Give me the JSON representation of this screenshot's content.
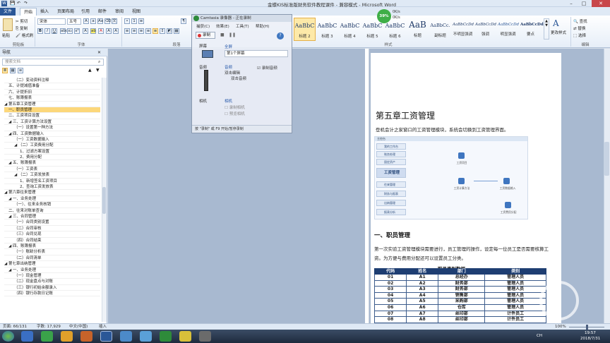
{
  "window": {
    "title": "金蝶KIS标准版财务软件教程课件 - 兼容模式 - Microsoft Word",
    "minimize": "–",
    "maximize": "□",
    "close": "✕"
  },
  "ribbon_tabs": [
    "文件",
    "开始",
    "插入",
    "页面布局",
    "引用",
    "邮件",
    "审阅",
    "视图"
  ],
  "ribbon": {
    "clipboard": {
      "paste": "粘贴",
      "cut": "剪切",
      "copy": "复制",
      "format_painter": "格式刷",
      "label": "剪贴板"
    },
    "font": {
      "name": "宋体",
      "size": "五号",
      "label": "字体"
    },
    "paragraph": {
      "label": "段落"
    },
    "styles": {
      "label": "样式",
      "items": [
        {
          "sample": "AaBbC",
          "name": "标题 2"
        },
        {
          "sample": "AaBbC",
          "name": "标题 3"
        },
        {
          "sample": "AaBbC",
          "name": "标题 4"
        },
        {
          "sample": "AaBbC",
          "name": "标题 5"
        },
        {
          "sample": "AaBbC",
          "name": "标题 6"
        },
        {
          "sample": "AaB",
          "name": "标题"
        },
        {
          "sample": "AaBbCc.",
          "name": "副标题"
        },
        {
          "sample": "AaBbCcDd",
          "name": "不明显强调"
        },
        {
          "sample": "AaBbCcDd",
          "name": "强调"
        },
        {
          "sample": "AaBbCcDd",
          "name": "明显强调"
        },
        {
          "sample": "AaBbCcDd",
          "name": "要点"
        }
      ],
      "change_styles": "更改样式"
    },
    "editing": {
      "find": "查找",
      "replace": "替换",
      "select": "选择",
      "label": "编辑"
    }
  },
  "timer": {
    "percent": "39%",
    "up": "0K/s",
    "down": "0K/s"
  },
  "camtasia": {
    "title": "Camtasia 录像器 - 正在录制",
    "menu": [
      "捕获(C)",
      "效果(E)",
      "工具(T)",
      "帮助(H)"
    ],
    "record_button": "录制",
    "screen_label": "屏幕",
    "screen_area": "全屏",
    "screen_value": "第1个屏幕",
    "audio_label": "音频",
    "audio_link": "音频",
    "audio_device": "双击编辑",
    "audio_checkbox": "录制音频",
    "audio_source": "双击音频",
    "camera_label": "相机",
    "camera_link": "相机",
    "camera_opt1": "录制相机",
    "camera_opt2": "预览相机",
    "hint": "按 \"录制\" 或 F9 开始/暂停录制"
  },
  "navigation": {
    "title": "导航",
    "search_placeholder": "搜索文档",
    "items": [
      {
        "text": "（二）变动资料注释",
        "sel": false
      },
      {
        "text": "五、计提减值准备",
        "sel": false
      },
      {
        "text": "六、计提折旧",
        "sel": false
      },
      {
        "text": "七、账簿报表",
        "sel": false
      },
      {
        "text": "◢ 第五章工资管理",
        "sel": false
      },
      {
        "text": "一、职员管理",
        "sel": true
      },
      {
        "text": "二、工资项目设置",
        "sel": false
      },
      {
        "text": "◢ 三、工资计算方法设置",
        "sel": false
      },
      {
        "text": "（一）设置第一种方法",
        "sel": false
      },
      {
        "text": "◢ 四、工资数据输入",
        "sel": false
      },
      {
        "text": "（一）工资数据输入",
        "sel": false
      },
      {
        "text": "◢ （二）工资费用分配",
        "sel": false
      },
      {
        "text": "1、过滤方案设置",
        "sel": false
      },
      {
        "text": "2、费用分配",
        "sel": false
      },
      {
        "text": "◢ 五、账簿报表",
        "sel": false
      },
      {
        "text": "（一）工资表",
        "sel": false
      },
      {
        "text": "◢ （二）工资发放表",
        "sel": false
      },
      {
        "text": "1、新增签名工资项目",
        "sel": false
      },
      {
        "text": "2、查询工资发放表",
        "sel": false
      },
      {
        "text": "◢ 第六章往来管理",
        "sel": false
      },
      {
        "text": "◢ 一、业务处理",
        "sel": false
      },
      {
        "text": "（一）、往来业务核销",
        "sel": false
      },
      {
        "text": "二、往来对账单查询",
        "sel": false
      },
      {
        "text": "◢ 三、合同管理",
        "sel": false
      },
      {
        "text": "（一）合同类别设置",
        "sel": false
      },
      {
        "text": "（二）合同审核",
        "sel": false
      },
      {
        "text": "（三）合同兑现",
        "sel": false
      },
      {
        "text": "（四）合同结束",
        "sel": false
      },
      {
        "text": "◢ 四、账簿报表",
        "sel": false
      },
      {
        "text": "（一）账龄分析表",
        "sel": false
      },
      {
        "text": "（二）合同清单",
        "sel": false
      },
      {
        "text": "◢ 第七章出纳管理",
        "sel": false
      },
      {
        "text": "◢ 一、业务处理",
        "sel": false
      },
      {
        "text": "（一）现金管理",
        "sel": false
      },
      {
        "text": "（二）现金盘点与对账",
        "sel": false
      },
      {
        "text": "（三）银行初始余额录入",
        "sel": false
      },
      {
        "text": "（四）银行存款日记账",
        "sel": false
      }
    ]
  },
  "document": {
    "chapter_title": "第五章工资管理",
    "intro": "登机会计之家窗口的工资管理模块，系统会切换到工资管理界面。",
    "figure": {
      "header": "主控台",
      "menus": [
        "我的工作台",
        "账务处理",
        "固定资产",
        "工资管理",
        "往来管理",
        "财务与报表",
        "出纳管理",
        "报表分析"
      ],
      "nodes": [
        "工资项目",
        "工资计算方法",
        "工资数据输入",
        "工资费用分配"
      ]
    },
    "section_title": "一、职员管理",
    "para": "第一次实验工资管理模块需要进行，员工管理的操作，设定每一位员工是否需要核算工资。为方便与费用分配还可以设置员工分类。",
    "table_caption": "职员类别数据",
    "table_headers": [
      "代码",
      "姓名",
      "部门",
      "类别"
    ],
    "table_rows": [
      [
        "01",
        "A1",
        "总经办",
        "管理人员"
      ],
      [
        "02",
        "A2",
        "财务部",
        "管理人员"
      ],
      [
        "03",
        "A3",
        "财务部",
        "管理人员"
      ],
      [
        "04",
        "A4",
        "销售部",
        "管理人员"
      ],
      [
        "05",
        "A5",
        "采购部",
        "管理人员"
      ],
      [
        "06",
        "A6",
        "仓库",
        "管理人员"
      ],
      [
        "07",
        "A7",
        "丝印部",
        "计件员工"
      ],
      [
        "08",
        "A8",
        "丝印部",
        "计件员工"
      ]
    ]
  },
  "statusbar": {
    "page": "页面: 66/131",
    "words": "字数: 17,929",
    "lang": "中文(中国)",
    "mode": "插入",
    "zoom": "100%"
  },
  "taskbar": {
    "time": "19:57",
    "date": "2018/7/31",
    "lang": "CH"
  }
}
